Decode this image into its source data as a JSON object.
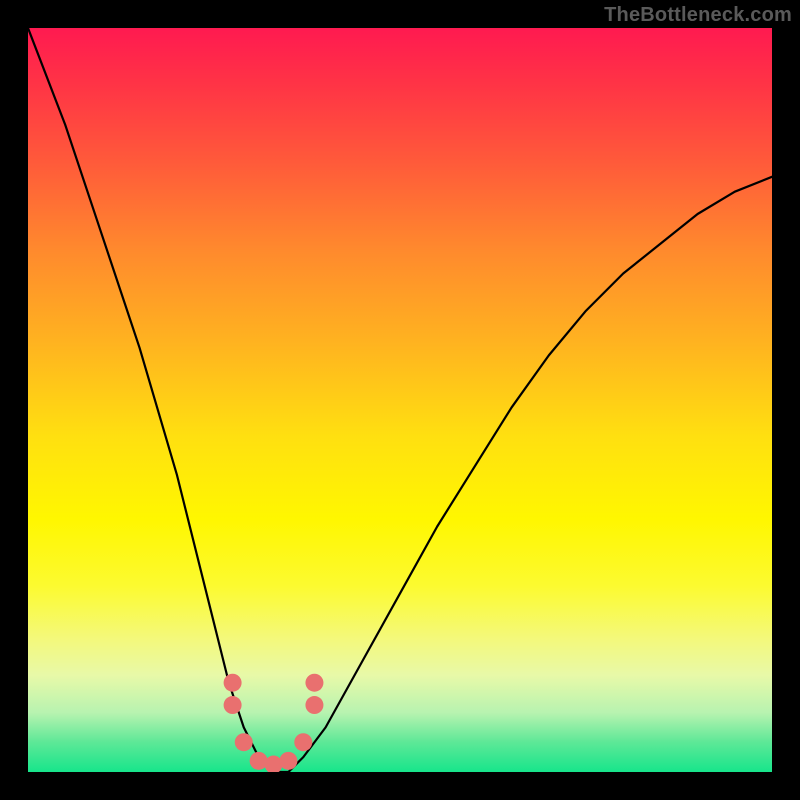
{
  "watermark": "TheBottleneck.com",
  "chart_data": {
    "type": "line",
    "title": "",
    "xlabel": "",
    "ylabel": "",
    "xlim": [
      0,
      100
    ],
    "ylim": [
      0,
      100
    ],
    "series": [
      {
        "name": "bottleneck-curve",
        "x": [
          0,
          5,
          10,
          15,
          20,
          25,
          27,
          29,
          31,
          33,
          35,
          37,
          40,
          45,
          50,
          55,
          60,
          65,
          70,
          75,
          80,
          85,
          90,
          95,
          100
        ],
        "values": [
          100,
          87,
          72,
          57,
          40,
          20,
          12,
          6,
          2,
          0,
          0,
          2,
          6,
          15,
          24,
          33,
          41,
          49,
          56,
          62,
          67,
          71,
          75,
          78,
          80
        ]
      }
    ],
    "markers": {
      "name": "highlight-dots",
      "points": [
        {
          "x": 27.5,
          "y": 12
        },
        {
          "x": 27.5,
          "y": 9
        },
        {
          "x": 29,
          "y": 4
        },
        {
          "x": 31,
          "y": 1.5
        },
        {
          "x": 33,
          "y": 1
        },
        {
          "x": 35,
          "y": 1.5
        },
        {
          "x": 37,
          "y": 4
        },
        {
          "x": 38.5,
          "y": 9
        },
        {
          "x": 38.5,
          "y": 12
        }
      ],
      "color": "#e9706f",
      "radius_px": 9
    },
    "gradient_stops": [
      {
        "pct": 0,
        "color": "#ff1a50"
      },
      {
        "pct": 55,
        "color": "#ffe010"
      },
      {
        "pct": 100,
        "color": "#17e58b"
      }
    ]
  }
}
